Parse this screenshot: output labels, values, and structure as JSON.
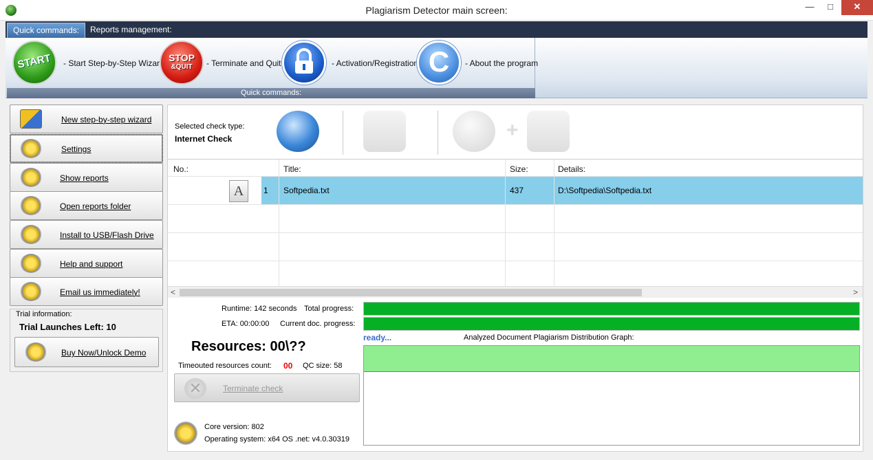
{
  "window": {
    "title": "Plagiarism Detector main screen:",
    "minimize": "—",
    "maximize": "□",
    "close": "✕"
  },
  "ribbon": {
    "tabs": [
      {
        "label": "Quick commands:"
      },
      {
        "label": "Reports management:"
      }
    ],
    "group_label": "Quick commands:",
    "buttons": [
      {
        "label": "- Start Step-by-Step Wizard",
        "icon": "start-button-icon",
        "icon_text": "START"
      },
      {
        "label": "- Terminate and Quit",
        "icon": "stop-quit-icon",
        "icon_text_1": "STOP",
        "icon_text_2": "&QUIT"
      },
      {
        "label": "- Activation/Registration",
        "icon": "padlock-icon"
      },
      {
        "label": "- About the program",
        "icon": "copyright-icon",
        "icon_text": "C"
      }
    ]
  },
  "sidebar": {
    "items": [
      {
        "label": "New step-by-step wizard",
        "icon": "wizard-icon"
      },
      {
        "label": "Settings",
        "icon": "gear-tools-icon"
      },
      {
        "label": "Show reports",
        "icon": "gear-report-icon"
      },
      {
        "label": "Open reports folder",
        "icon": "gear-folder-icon"
      },
      {
        "label": "Install to USB/Flash Drive",
        "icon": "gear-usb-icon"
      },
      {
        "label": "Help and support",
        "icon": "lifebuoy-icon"
      },
      {
        "label": "Email us immediately!",
        "icon": "lifebuoy-email-icon"
      }
    ]
  },
  "trial": {
    "label": "Trial information:",
    "launches": "Trial Launches Left: 10",
    "buy_label": "Buy Now/Unlock Demo"
  },
  "check": {
    "label": "Selected check type:",
    "value": "Internet Check",
    "plus": "+"
  },
  "table": {
    "columns": [
      "No.:",
      "Title:",
      "Size:",
      "Details:"
    ],
    "rows": [
      {
        "no": "1",
        "title": "Softpedia.txt",
        "size": "437",
        "details": "D:\\Softpedia\\Softpedia.txt",
        "icon_letter": "A"
      }
    ],
    "scroll_left": "<",
    "scroll_right": ">"
  },
  "progress": {
    "runtime": "Runtime: 142 seconds",
    "total_label": "Total progress:",
    "total_value": 100,
    "eta": "ETA: 00:00:00",
    "current_label": "Current doc. progress:",
    "current_value": 100,
    "status": "ready...",
    "graph_title": "Analyzed Document Plagiarism Distribution Graph:"
  },
  "resources": {
    "title": "Resources: 00\\??",
    "timeout_label": "Timeouted resources count:",
    "timeout_value": "00",
    "qc_size": "QC size: 58",
    "terminate_label": "Terminate check"
  },
  "footer": {
    "core_version": "Core version: 802",
    "os_version": "Operating system: x64 OS .net: v4.0.30319"
  },
  "colors": {
    "selected_row": "#87ceea",
    "progress_fill": "#06b025",
    "graph_band": "#90ee90",
    "timeout_value": "#e00000",
    "status_text": "#3a6bc8"
  }
}
